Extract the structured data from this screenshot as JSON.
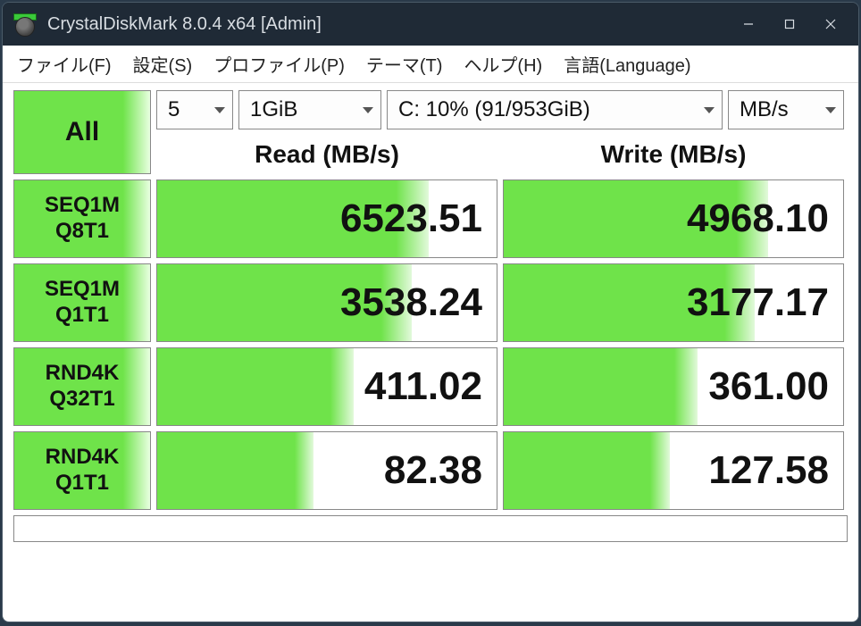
{
  "window": {
    "title": "CrystalDiskMark 8.0.4 x64 [Admin]"
  },
  "menu": {
    "file": "ファイル(F)",
    "settings": "設定(S)",
    "profile": "プロファイル(P)",
    "theme": "テーマ(T)",
    "help": "ヘルプ(H)",
    "language": "言語(Language)"
  },
  "selectors": {
    "count": "5",
    "size": "1GiB",
    "drive": "C: 10% (91/953GiB)",
    "unit": "MB/s"
  },
  "headers": {
    "read": "Read (MB/s)",
    "write": "Write (MB/s)"
  },
  "buttons": {
    "all": "All",
    "row1_l1": "SEQ1M",
    "row1_l2": "Q8T1",
    "row2_l1": "SEQ1M",
    "row2_l2": "Q1T1",
    "row3_l1": "RND4K",
    "row3_l2": "Q32T1",
    "row4_l1": "RND4K",
    "row4_l2": "Q1T1"
  },
  "results": {
    "r1_read": "6523.51",
    "r1_read_pct": 80,
    "r1_write": "4968.10",
    "r1_write_pct": 78,
    "r2_read": "3538.24",
    "r2_read_pct": 75,
    "r2_write": "3177.17",
    "r2_write_pct": 74,
    "r3_read": "411.02",
    "r3_read_pct": 58,
    "r3_write": "361.00",
    "r3_write_pct": 57,
    "r4_read": "82.38",
    "r4_read_pct": 46,
    "r4_write": "127.58",
    "r4_write_pct": 49
  }
}
